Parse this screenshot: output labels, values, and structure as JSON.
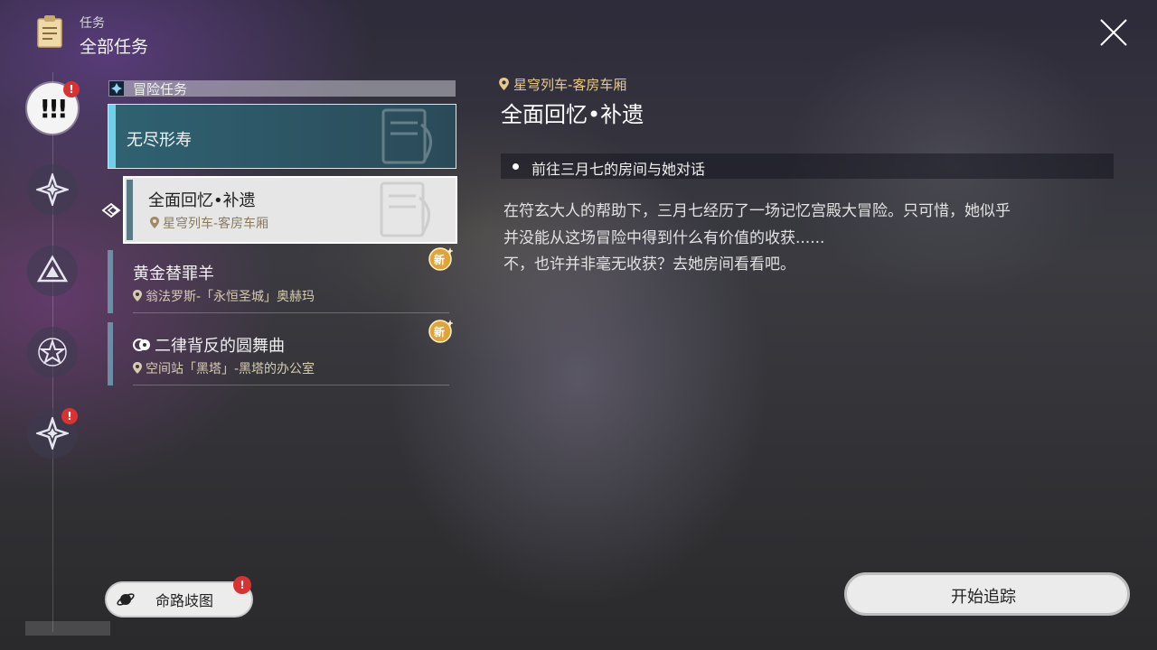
{
  "header": {
    "subtitle": "任务",
    "title": "全部任务",
    "icon": "clipboard-icon",
    "close_icon": "close-icon"
  },
  "sidebar": {
    "categories": [
      {
        "name": "trailblaze-mission",
        "icon": "exclamation-icon",
        "active": true,
        "has_alert": true
      },
      {
        "name": "companion-mission",
        "icon": "diamond-star-icon",
        "active": false,
        "has_alert": false
      },
      {
        "name": "adventure-mission",
        "icon": "triangle-icon",
        "active": false,
        "has_alert": false
      },
      {
        "name": "daily-mission",
        "icon": "star-icon",
        "active": false,
        "has_alert": false
      },
      {
        "name": "event-mission",
        "icon": "sparkle-icon",
        "active": false,
        "has_alert": true
      }
    ],
    "badge_symbol": "!"
  },
  "quest_list": {
    "section_label": "冒险任务",
    "quests": [
      {
        "title": "无尽形寿",
        "location": "",
        "state": "category-header"
      },
      {
        "title": "全面回忆•补遗",
        "location": "星穹列车-客房车厢",
        "state": "selected"
      },
      {
        "title": "黄金替罪羊",
        "location": "翁法罗斯-「永恒圣城」奥赫玛",
        "is_new": true
      },
      {
        "title": "二律背反的圆舞曲",
        "location": "空间站「黑塔」-黑塔的办公室",
        "is_new": true
      }
    ],
    "new_badge": "新"
  },
  "detail": {
    "location": "星穹列车-客房车厢",
    "title": "全面回忆•补遗",
    "objective": "前往三月七的房间与她对话",
    "description_lines": [
      "在符玄大人的帮助下，三月七经历了一场记忆宫殿大冒险。只可惜，她似乎",
      "并没能从这场冒险中得到什么有价值的收获......",
      "不，也许并非毫无收获？去她房间看看吧。"
    ]
  },
  "footer": {
    "path_button": "命路歧图",
    "track_button": "开始追踪"
  },
  "colors": {
    "accent_cyan": "#6fd0ea",
    "location_gold": "#e8c98a",
    "alert_red": "#d83232",
    "new_badge_gold": "#e0a43a"
  }
}
